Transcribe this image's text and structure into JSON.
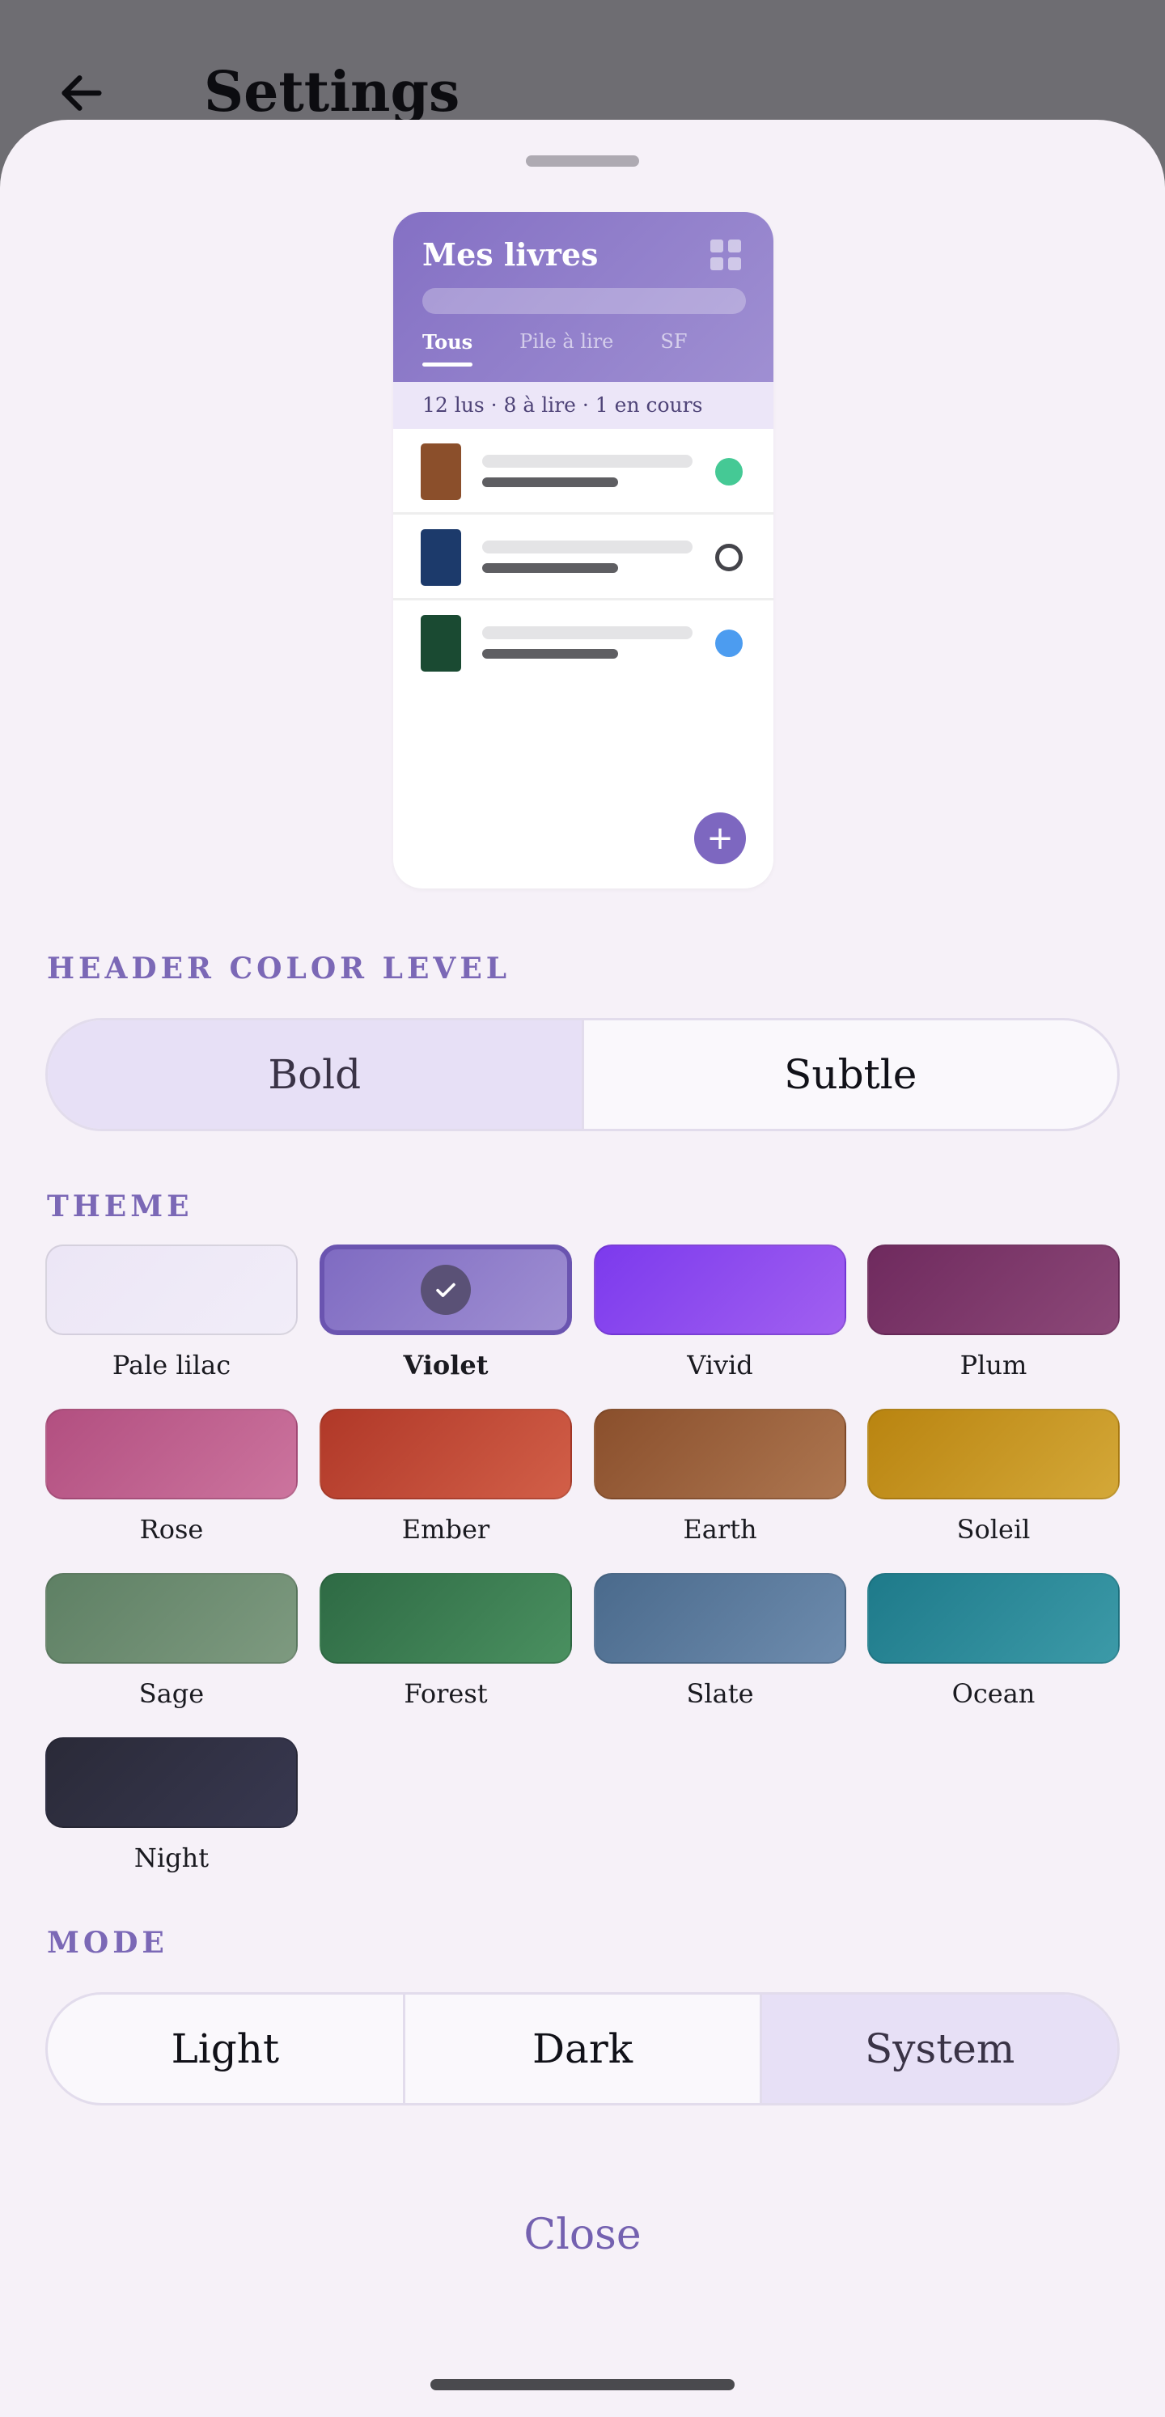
{
  "app_bar": {
    "title": "Settings",
    "back_icon": "arrow-left-icon"
  },
  "preview": {
    "title": "Mes livres",
    "grid_icon": "grid-view-icon",
    "tabs": [
      {
        "label": "Tous",
        "active": true
      },
      {
        "label": "Pile à lire",
        "active": false
      },
      {
        "label": "SF",
        "active": false
      }
    ],
    "stats": "12 lus · 8 à lire · 1 en cours",
    "rows": [
      {
        "cover_color": "#8b4f2b",
        "status_color": "#45c995",
        "status": "filled"
      },
      {
        "cover_color": "#1c3a6b",
        "status_color": "#44444a",
        "status": "outline"
      },
      {
        "cover_color": "#1a4a32",
        "status_color": "#4c9cf0",
        "status": "filled"
      }
    ],
    "fab_icon": "plus-icon",
    "header_color": "#8a76c8"
  },
  "header_level": {
    "label": "HEADER COLOR LEVEL",
    "options": [
      {
        "label": "Bold",
        "selected": true
      },
      {
        "label": "Subtle",
        "selected": false
      }
    ]
  },
  "theme": {
    "label": "THEME",
    "check_icon": "checkmark-icon",
    "swatches": [
      {
        "name": "Pale lilac",
        "from": "#ece6f6",
        "to": "#f1edf8",
        "selected": false
      },
      {
        "name": "Violet",
        "from": "#7f6bc2",
        "to": "#9f8fd2",
        "selected": true
      },
      {
        "name": "Vivid",
        "from": "#7c3aed",
        "to": "#a160f0",
        "selected": false
      },
      {
        "name": "Plum",
        "from": "#6f2a5e",
        "to": "#8c4878",
        "selected": false
      },
      {
        "name": "Rose",
        "from": "#b24f80",
        "to": "#cc749e",
        "selected": false
      },
      {
        "name": "Ember",
        "from": "#b03828",
        "to": "#d25f48",
        "selected": false
      },
      {
        "name": "Earth",
        "from": "#8a4f2c",
        "to": "#ad7650",
        "selected": false
      },
      {
        "name": "Soleil",
        "from": "#b98410",
        "to": "#d4a838",
        "selected": false
      },
      {
        "name": "Sage",
        "from": "#5e8064",
        "to": "#7e9a80",
        "selected": false
      },
      {
        "name": "Forest",
        "from": "#2e6a44",
        "to": "#4a9060",
        "selected": false
      },
      {
        "name": "Slate",
        "from": "#4a6a8c",
        "to": "#6e8cae",
        "selected": false
      },
      {
        "name": "Ocean",
        "from": "#1e7a8a",
        "to": "#3c9aa8",
        "selected": false
      },
      {
        "name": "Night",
        "from": "#2a2a38",
        "to": "#383850",
        "selected": false
      }
    ]
  },
  "mode": {
    "label": "MODE",
    "options": [
      {
        "label": "Light",
        "selected": false
      },
      {
        "label": "Dark",
        "selected": false
      },
      {
        "label": "System",
        "selected": true
      }
    ]
  },
  "close_label": "Close"
}
